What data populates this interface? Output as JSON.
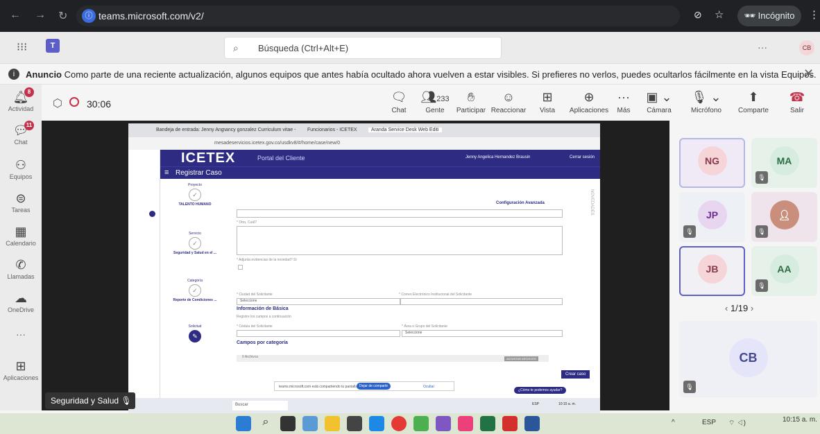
{
  "browser": {
    "url": "teams.microsoft.com/v2/",
    "incognito_label": "Incógnito",
    "back_icon": "arrow-left-icon",
    "forward_icon": "arrow-right-icon",
    "reload_icon": "reload-icon"
  },
  "teams": {
    "search_placeholder": "Búsqueda (Ctrl+Alt+E)",
    "more": "···",
    "user_initials": "CB",
    "banner": {
      "title": "Anuncio",
      "text": "Como parte de una reciente actualización, algunos equipos que antes había ocultado ahora vuelven a estar visibles. Si prefieres no verlos, puedes ocultarlos fácilmente en la vista Equipos."
    },
    "rail": [
      {
        "label": "Actividad",
        "icon": "bell-icon",
        "badge": "8"
      },
      {
        "label": "Chat",
        "icon": "chat-icon",
        "badge": "11"
      },
      {
        "label": "Equipos",
        "icon": "teams-icon",
        "badge": ""
      },
      {
        "label": "Tareas",
        "icon": "tasks-icon",
        "badge": ""
      },
      {
        "label": "Calendario",
        "icon": "calendar-icon",
        "badge": ""
      },
      {
        "label": "Llamadas",
        "icon": "phone-icon",
        "badge": ""
      },
      {
        "label": "OneDrive",
        "icon": "cloud-icon",
        "badge": ""
      },
      {
        "label": "···",
        "icon": "more-icon",
        "badge": ""
      },
      {
        "label": "Aplicaciones",
        "icon": "plus-icon",
        "badge": ""
      }
    ],
    "call": {
      "timer": "30:06",
      "people_count": "233",
      "controls": [
        {
          "label": "Chat",
          "icon": "chat-icon"
        },
        {
          "label": "Gente",
          "icon": "people-icon"
        },
        {
          "label": "Participar",
          "icon": "hand-icon"
        },
        {
          "label": "Reaccionar",
          "icon": "smile-icon"
        },
        {
          "label": "Vista",
          "icon": "grid-icon"
        },
        {
          "label": "Aplicaciones",
          "icon": "plus-icon"
        },
        {
          "label": "Más",
          "icon": "more-icon"
        },
        {
          "label": "Cámara",
          "icon": "camera-off-icon"
        },
        {
          "label": "Micrófono",
          "icon": "mic-off-icon"
        },
        {
          "label": "Comparte",
          "icon": "share-icon"
        },
        {
          "label": "Salir",
          "icon": "hangup-icon"
        }
      ]
    },
    "participants": [
      {
        "initials": "NG",
        "muted": false
      },
      {
        "initials": "MA",
        "muted": true
      },
      {
        "initials": "JP",
        "muted": true
      },
      {
        "initials": "",
        "muted": true
      },
      {
        "initials": "JB",
        "muted": false
      },
      {
        "initials": "AA",
        "muted": true
      }
    ],
    "pager": "1/19",
    "self_initials": "CB",
    "presenter_name": "Seguridad y Salud"
  },
  "shared_screen": {
    "tabs": [
      "Bandeja de entrada: Jenny Ang",
      "nancy gonzalez Curriculum vitae -",
      "Funcionarios - ICETEX",
      "Aranda Service Desk Web Editi"
    ],
    "address": "mesadeservicios.icetex.gov.co/usdkv8/#/home/case/new/0",
    "brand": "ICETEX",
    "portal": "Portal del Cliente",
    "user": "Jenny Angelica Hernandez Brausin",
    "logout": "Cerrar sesión",
    "page_title": "Registrar Caso",
    "advanced": "Configuración Avanzada",
    "novedades": "NOVEDADES",
    "steps": [
      {
        "cat": "Proyecto",
        "value": "TALENTO HUMANO"
      },
      {
        "cat": "Servicio",
        "value": "Seguridad y Salud en el ..."
      },
      {
        "cat": "Categoría",
        "value": "Reporte de Condiciones ..."
      },
      {
        "cat": "Solicitud",
        "value": ""
      }
    ],
    "fields": {
      "other": "* Otro, Cuál?",
      "evidence": "* Adjunta evidencias de la novedad? Sí",
      "city": "* Ciudad del Solicitante",
      "city_value": "Seleccione",
      "email": "* Correo Electrónico Institucional del Solicitante",
      "basic_info": "Información de Básica",
      "basic_hint": "Registre los campos a continuación",
      "id": "* Cédula del Solicitante",
      "area": "* Área o Grupo del Solicitante",
      "area_value": "Seleccione",
      "category_fields": "Campos por categoría",
      "files": "0 Archivos",
      "attach": "ADJUNTAR ARCHIVOS",
      "create": "Crear caso"
    },
    "sharing_msg": "teams.microsoft.com está compartiendo tu pantalla.",
    "stop_share": "Dejar de compartir",
    "hide": "Ocultar",
    "help": "¿Cómo te podemos ayudar?",
    "inner_search": "Buscar",
    "inner_lang": "ESP",
    "inner_time": "10:15 a. m."
  },
  "taskbar": {
    "lang": "ESP",
    "time": "10:15 a. m."
  }
}
